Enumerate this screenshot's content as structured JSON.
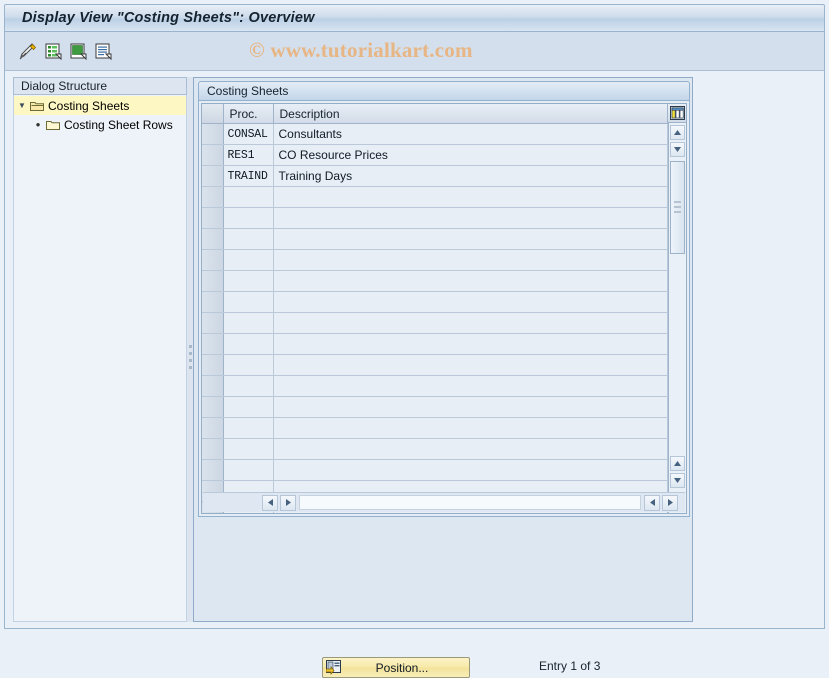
{
  "window": {
    "title": "Display View \"Costing Sheets\": Overview"
  },
  "watermark": {
    "text": "© www.tutorialkart.com"
  },
  "toolbar": {
    "buttons": [
      {
        "name": "display-change-icon",
        "tooltip": "Display -> Change"
      },
      {
        "name": "new-entries-icon",
        "tooltip": "New Entries"
      },
      {
        "name": "copy-as-icon",
        "tooltip": "Copy As..."
      },
      {
        "name": "details-icon",
        "tooltip": "Details"
      }
    ]
  },
  "sidebar": {
    "header": "Dialog Structure",
    "items": [
      {
        "label": "Costing Sheets",
        "level": 0,
        "selected": true,
        "expanded": true,
        "icon": "open-folder-icon"
      },
      {
        "label": "Costing Sheet Rows",
        "level": 1,
        "selected": false,
        "expanded": false,
        "icon": "folder-icon"
      }
    ]
  },
  "main": {
    "group_title": "Costing Sheets",
    "table": {
      "columns": [
        "Proc.",
        "Description"
      ],
      "rows": [
        {
          "proc": "CONSAL",
          "description": "Consultants"
        },
        {
          "proc": "RES1",
          "description": "CO Resource Prices"
        },
        {
          "proc": "TRAIND",
          "description": "Training Days"
        }
      ],
      "empty_row_count": 17,
      "column_config_icon": "table-settings-icon"
    },
    "scroll": {
      "v_up_top": "▲",
      "v_down_top": "▼",
      "v_up_bottom": "▲",
      "v_down_bottom": "▼",
      "h_left": "◄",
      "h_right": "►"
    },
    "position_button": {
      "label": "Position...",
      "icon": "position-icon"
    },
    "entry_status": "Entry 1 of 3"
  },
  "colors": {
    "accent": "#bcd0e6",
    "selected_row": "#fdf7c4",
    "button": "#f7e9a8",
    "watermark": "#e8b584"
  }
}
